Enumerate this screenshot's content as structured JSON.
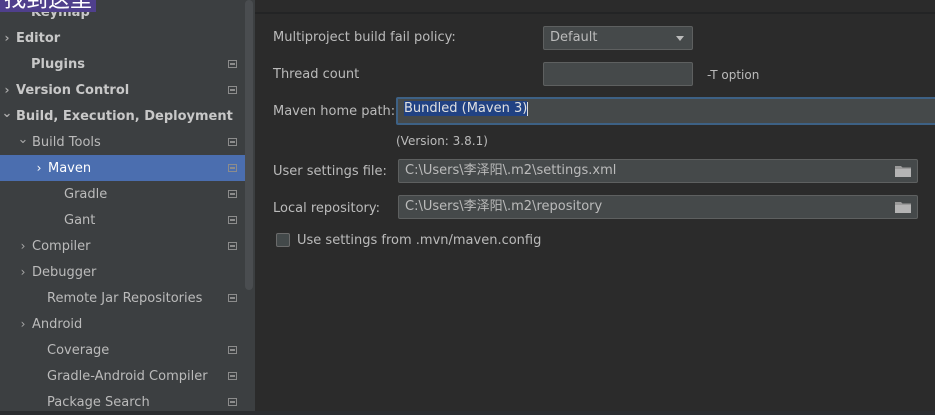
{
  "overlay_text": "找到这里",
  "sidebar": {
    "items": [
      {
        "label": "Keymap",
        "bold": true,
        "arrow": "",
        "proj": false
      },
      {
        "label": "Editor",
        "bold": true,
        "arrow": "›",
        "proj": false
      },
      {
        "label": "Plugins",
        "bold": true,
        "arrow": "",
        "proj": true
      },
      {
        "label": "Version Control",
        "bold": true,
        "arrow": "›",
        "proj": true
      },
      {
        "label": "Build, Execution, Deployment",
        "bold": true,
        "arrow": "⌄",
        "proj": false
      },
      {
        "label": "Build Tools",
        "bold": false,
        "arrow": "⌄",
        "proj": true
      },
      {
        "label": "Maven",
        "bold": false,
        "arrow": "›",
        "proj": true
      },
      {
        "label": "Gradle",
        "bold": false,
        "arrow": "",
        "proj": true
      },
      {
        "label": "Gant",
        "bold": false,
        "arrow": "",
        "proj": true
      },
      {
        "label": "Compiler",
        "bold": false,
        "arrow": "›",
        "proj": true
      },
      {
        "label": "Debugger",
        "bold": false,
        "arrow": "›",
        "proj": false
      },
      {
        "label": "Remote Jar Repositories",
        "bold": false,
        "arrow": "",
        "proj": true
      },
      {
        "label": "Android",
        "bold": false,
        "arrow": "›",
        "proj": false
      },
      {
        "label": "Coverage",
        "bold": false,
        "arrow": "",
        "proj": true
      },
      {
        "label": "Gradle-Android Compiler",
        "bold": false,
        "arrow": "",
        "proj": true
      },
      {
        "label": "Package Search",
        "bold": false,
        "arrow": "",
        "proj": true
      }
    ]
  },
  "maven": {
    "fail_policy_label": "Multiproject build fail policy:",
    "fail_policy_value": "Default",
    "thread_count_label": "Thread count",
    "thread_count_value": "",
    "t_option": "-T option",
    "home_label": "Maven home path:",
    "home_value": "Bundled (Maven 3)",
    "version_text": "(Version: 3.8.1)",
    "user_settings_label": "User settings file:",
    "user_settings_value": "C:\\Users\\李泽阳\\.m2\\settings.xml",
    "local_repo_label": "Local repository:",
    "local_repo_value": "C:\\Users\\李泽阳\\.m2\\repository",
    "mvn_config_label": "Use settings from .mvn/maven.config",
    "mvn_config_checked": false
  },
  "colors": {
    "selection": "#4b6eaf",
    "sidebar_bg": "#3c3f41",
    "content_bg": "#2b2b2b",
    "overlay_bg": "#4f3f8c"
  }
}
